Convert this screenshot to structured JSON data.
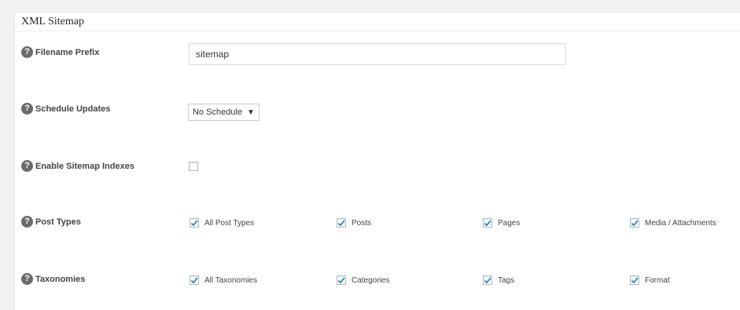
{
  "panel": {
    "title": "XML Sitemap"
  },
  "fields": {
    "filename_prefix": {
      "label": "Filename Prefix",
      "value": "sitemap"
    },
    "schedule_updates": {
      "label": "Schedule Updates",
      "selected": "No Schedule"
    },
    "enable_sitemap_indexes": {
      "label": "Enable Sitemap Indexes",
      "checked": false
    },
    "post_types": {
      "label": "Post Types",
      "options": [
        {
          "label": "All Post Types",
          "checked": true
        },
        {
          "label": "Posts",
          "checked": true
        },
        {
          "label": "Pages",
          "checked": true
        },
        {
          "label": "Media / Attachments",
          "checked": true
        }
      ]
    },
    "taxonomies": {
      "label": "Taxonomies",
      "options": [
        {
          "label": "All Taxonomies",
          "checked": true
        },
        {
          "label": "Categories",
          "checked": true
        },
        {
          "label": "Tags",
          "checked": true
        },
        {
          "label": "Format",
          "checked": true
        }
      ]
    }
  },
  "icons": {
    "help": "help-question-icon",
    "check": "checkmark-icon",
    "dropdown": "caret-down-icon"
  },
  "colors": {
    "check_mark": "#1e8cbe",
    "help_icon_bg": "#6b6b6b"
  }
}
